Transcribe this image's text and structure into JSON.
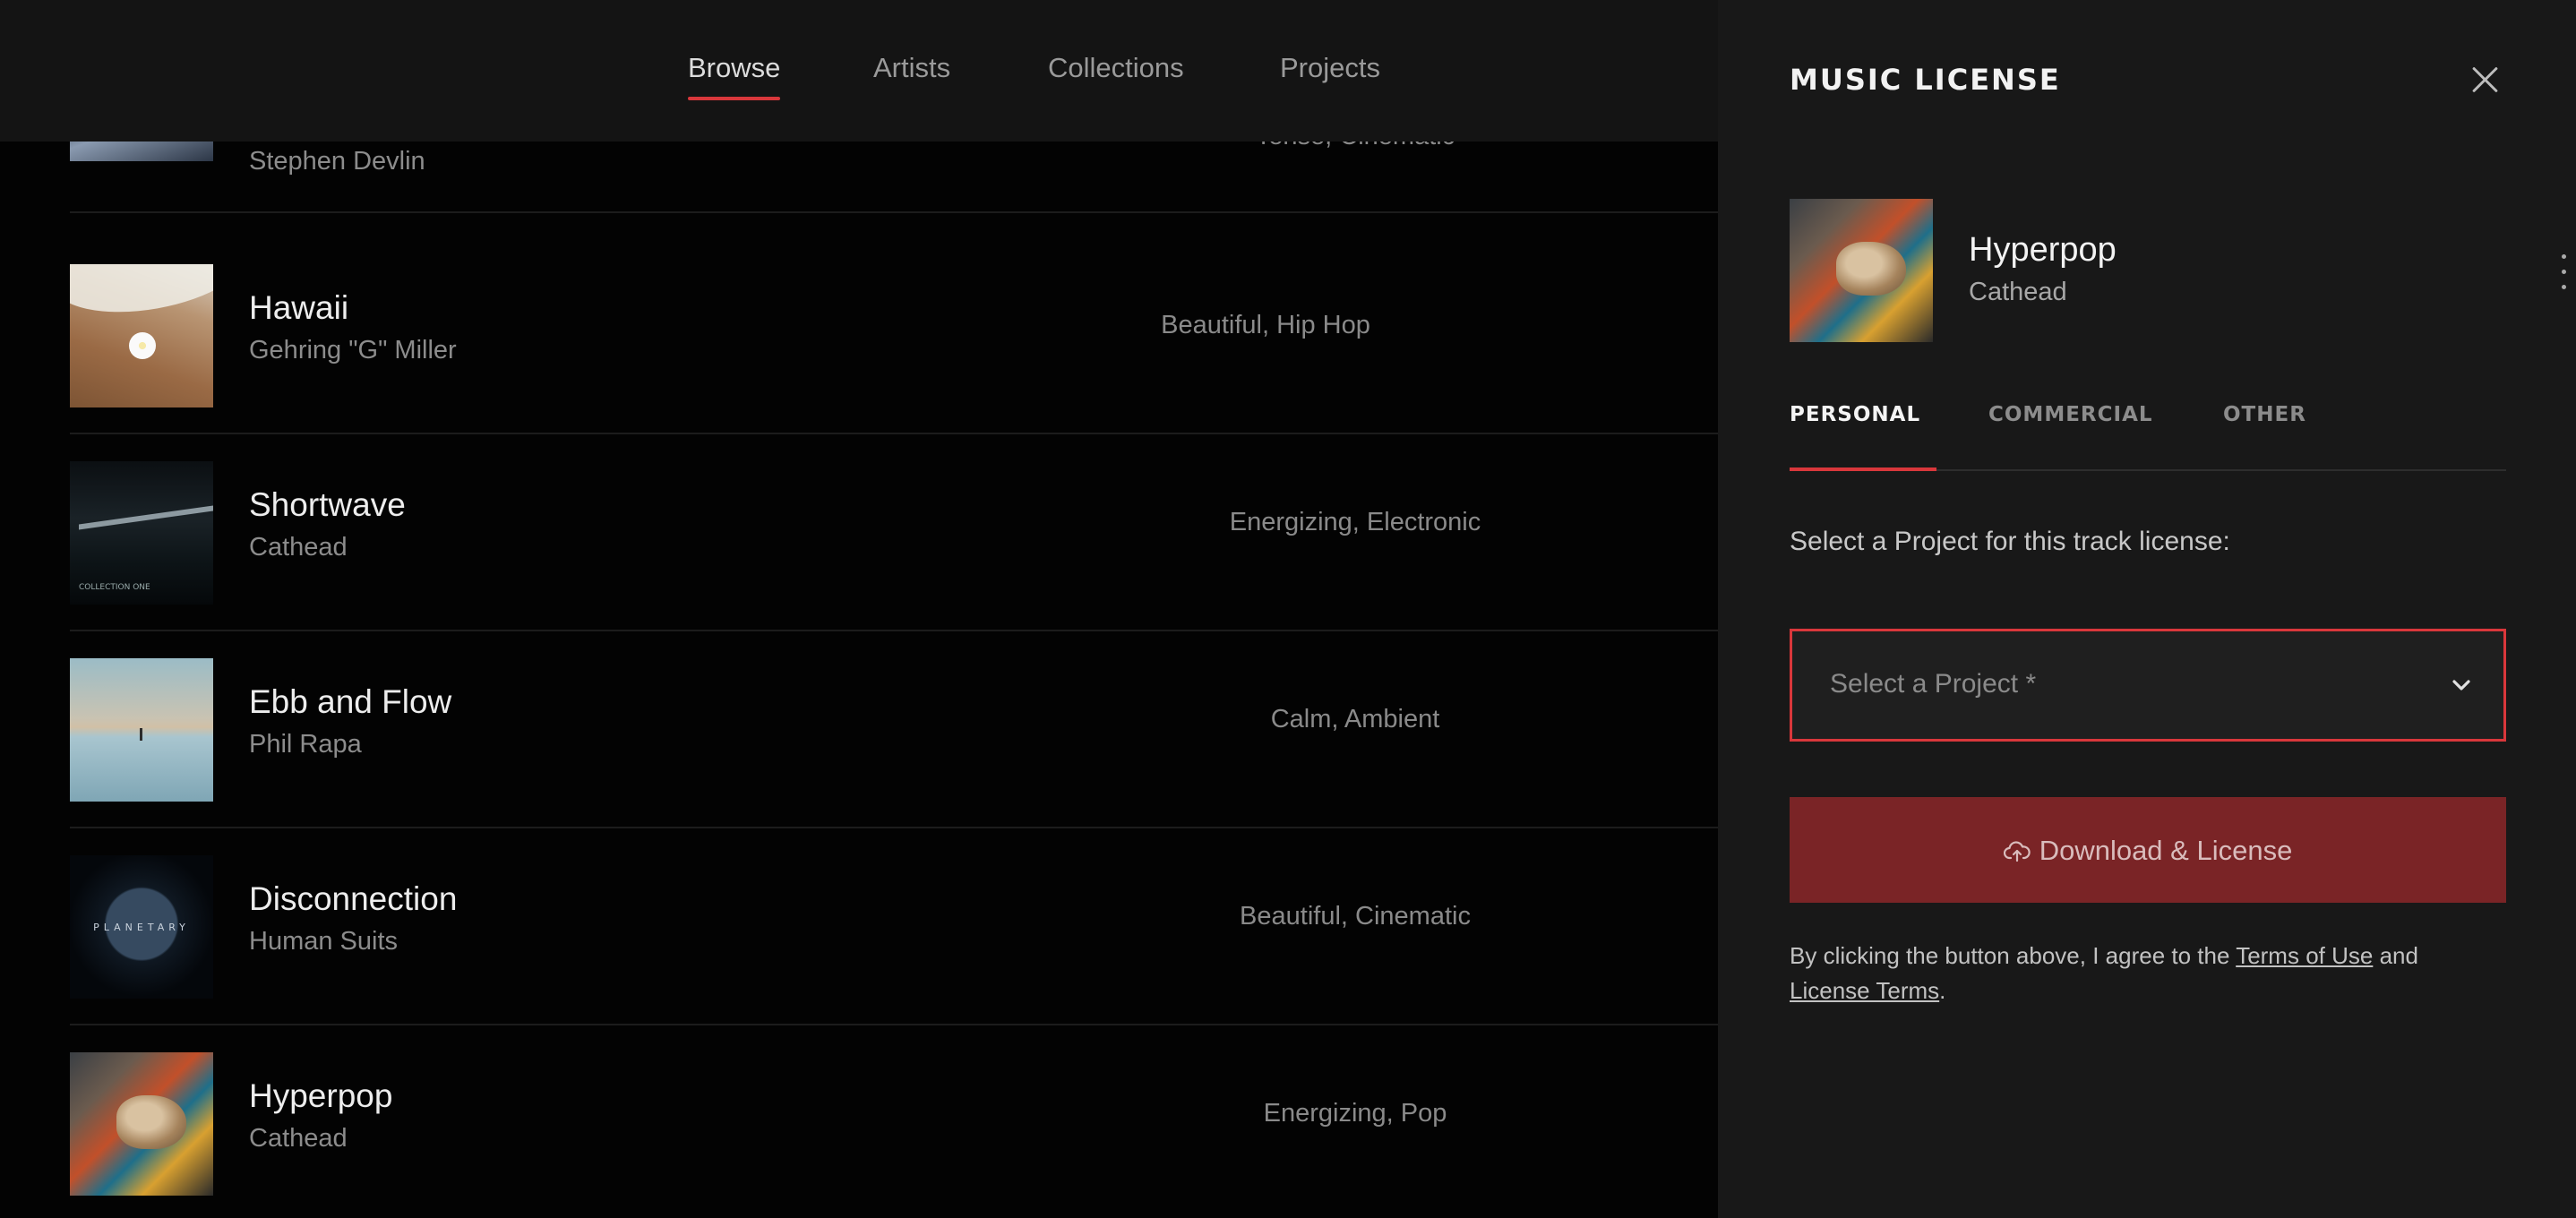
{
  "nav": {
    "items": [
      {
        "label": "Browse",
        "active": true
      },
      {
        "label": "Artists",
        "active": false
      },
      {
        "label": "Collections",
        "active": false
      },
      {
        "label": "Projects",
        "active": false
      }
    ]
  },
  "tracks": [
    {
      "title": "",
      "artist": "Stephen Devlin",
      "tags": [
        "Tense",
        "Cinematic"
      ],
      "thumb": "mountain-artwork"
    },
    {
      "title": "Hawaii",
      "artist": "Gehring \"G\" Miller",
      "tags": [
        "Beautiful",
        "Hip Hop"
      ],
      "thumb": "beach-flower-artwork"
    },
    {
      "title": "Shortwave",
      "artist": "Cathead",
      "tags": [
        "Energizing",
        "Electronic"
      ],
      "thumb": "pier-night-artwork"
    },
    {
      "title": "Ebb and Flow",
      "artist": "Phil Rapa",
      "tags": [
        "Calm",
        "Ambient"
      ],
      "thumb": "lake-reflection-artwork"
    },
    {
      "title": "Disconnection",
      "artist": "Human Suits",
      "tags": [
        "Beautiful",
        "Cinematic"
      ],
      "thumb": "planetary-artwork"
    },
    {
      "title": "Hyperpop",
      "artist": "Cathead",
      "tags": [
        "Energizing",
        "Pop"
      ],
      "thumb": "cat-blanket-artwork"
    }
  ],
  "thumb_text": {
    "shortwave": "COLLECTION ONE",
    "disconnection": "PLANETARY"
  },
  "panel": {
    "title": "MUSIC LICENSE",
    "track": {
      "title": "Hyperpop",
      "artist": "Cathead"
    },
    "tabs": [
      {
        "label": "PERSONAL",
        "active": true
      },
      {
        "label": "COMMERCIAL",
        "active": false
      },
      {
        "label": "OTHER",
        "active": false
      }
    ],
    "prompt": "Select a Project for this track license:",
    "select_placeholder": "Select a Project *",
    "download_label": "Download & License",
    "disclaimer": {
      "prefix": "By clicking the button above, I agree to the ",
      "terms_of_use": "Terms of Use",
      "middle": " and ",
      "license_terms": "License Terms",
      "suffix": "."
    }
  },
  "colors": {
    "accent": "#d9373b",
    "button_bg": "#7a2426",
    "panel_bg": "#181818",
    "nav_bg": "#141414"
  },
  "icons": [
    "close-icon",
    "more-vertical-icon",
    "chevron-down-icon",
    "cloud-upload-icon"
  ]
}
